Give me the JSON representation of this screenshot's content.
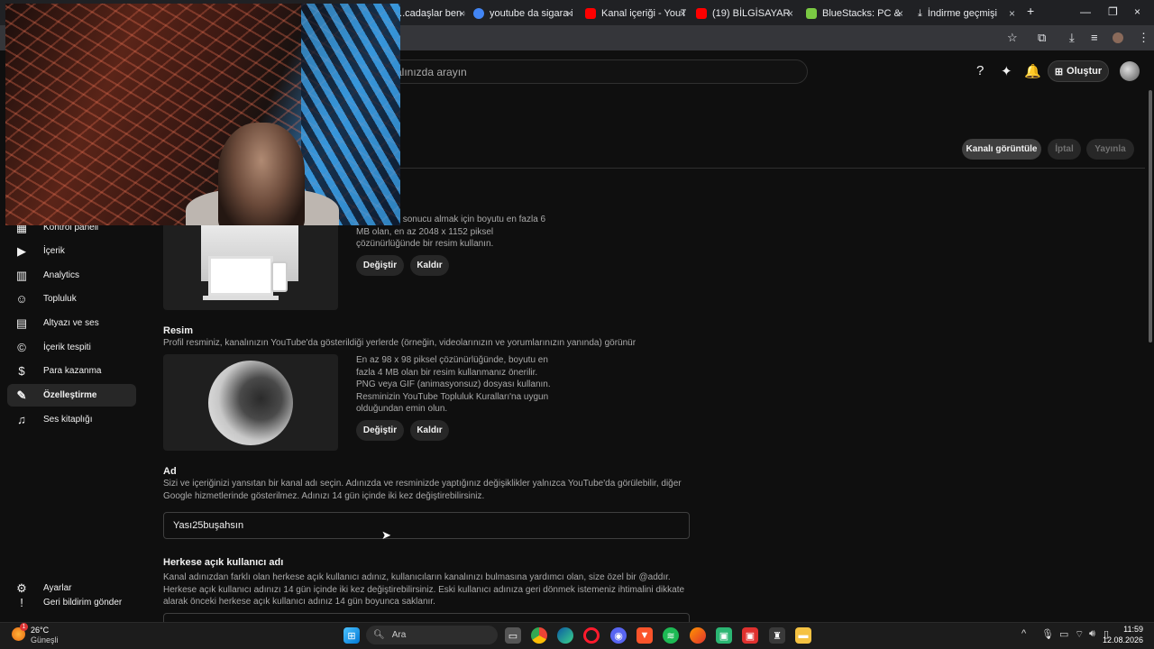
{
  "browser": {
    "tabs": [
      {
        "label": "...cadaşlar ben o",
        "color": "#4a4a4a"
      },
      {
        "label": "youtube da sigara iç",
        "color": "#4285f4"
      },
      {
        "label": "Kanal içeriği - YouTu",
        "color": "#ff0000"
      },
      {
        "label": "(19) BİLGİSAYAR",
        "color": "#ff0000"
      },
      {
        "label": "BlueStacks: PC & Mac",
        "color": "#7ac943"
      },
      {
        "label": "İndirme geçmişi",
        "color": "#e8eaed"
      }
    ],
    "new_tab": "+",
    "close_glyph": "×"
  },
  "header": {
    "search_placeholder": "...alınızda arayın",
    "create_label": "Oluştur"
  },
  "actions": {
    "view_channel": "Kanalı görüntüle",
    "cancel": "İptal",
    "publish": "Yayınla"
  },
  "sidebar": {
    "items": [
      {
        "label": "Kontrol paneli",
        "icon": "dashboard-icon",
        "glyph": "▦"
      },
      {
        "label": "İçerik",
        "icon": "content-icon",
        "glyph": "▶"
      },
      {
        "label": "Analytics",
        "icon": "analytics-icon",
        "glyph": "▥"
      },
      {
        "label": "Topluluk",
        "icon": "community-icon",
        "glyph": "☺"
      },
      {
        "label": "Altyazı ve ses",
        "icon": "subtitles-icon",
        "glyph": "▤"
      },
      {
        "label": "İçerik tespiti",
        "icon": "copyright-icon",
        "glyph": "©"
      },
      {
        "label": "Para kazanma",
        "icon": "monetization-icon",
        "glyph": "$"
      },
      {
        "label": "Özelleştirme",
        "icon": "customization-icon",
        "glyph": "✎"
      },
      {
        "label": "Ses kitaplığı",
        "icon": "audio-library-icon",
        "glyph": "♫"
      }
    ],
    "settings": "Ayarlar",
    "feedback": "Geri bildirim gönder"
  },
  "banner": {
    "desc": "...rda en iyi sonucu almak için boyutu en fazla 6 MB olan, en az 2048 x 1152 piksel çözünürlüğünde bir resim kullanın.",
    "change": "Değiştir",
    "remove": "Kaldır"
  },
  "picture": {
    "title": "Resim",
    "subtitle": "Profil resminiz, kanalınızın YouTube'da gösterildiği yerlerde (örneğin, videolarınızın ve yorumlarınızın yanında) görünür",
    "desc": "En az 98 x 98 piksel çözünürlüğünde, boyutu en fazla 4 MB olan bir resim kullanmanız önerilir. PNG veya GIF (animasyonsuz) dosyası kullanın. Resminizin YouTube Topluluk Kuralları'na uygun olduğundan emin olun.",
    "change": "Değiştir",
    "remove": "Kaldır"
  },
  "name": {
    "title": "Ad",
    "desc": "Sizi ve içeriğinizi yansıtan bir kanal adı seçin. Adınızda ve resminizde yaptığınız değişiklikler yalnızca YouTube'da görülebilir, diğer Google hizmetlerinde gösterilmez. Adınızı 14 gün içinde iki kez değiştirebilirsiniz.",
    "value": "Yası25buşahsın"
  },
  "handle": {
    "title": "Herkese açık kullanıcı adı",
    "desc": "Kanal adınızdan farklı olan herkese açık kullanıcı adınız, kullanıcıların kanalınızı bulmasına yardımcı olan, size özel bir @addır. Herkese açık kullanıcı adınızı 14 gün içinde iki kez değiştirebilirsiniz. Eski kullanıcı adınıza geri dönmek isteme­niz ihtimalini dikkate alarak önceki herkese açık kullanıcı adınız 14 gün boyunca saklanır."
  },
  "taskbar": {
    "weather_temp": "26°C",
    "weather_desc": "Güneşli",
    "weather_badge": "1",
    "search": "Ara",
    "time": "11:59",
    "date": "12.08.2026"
  }
}
